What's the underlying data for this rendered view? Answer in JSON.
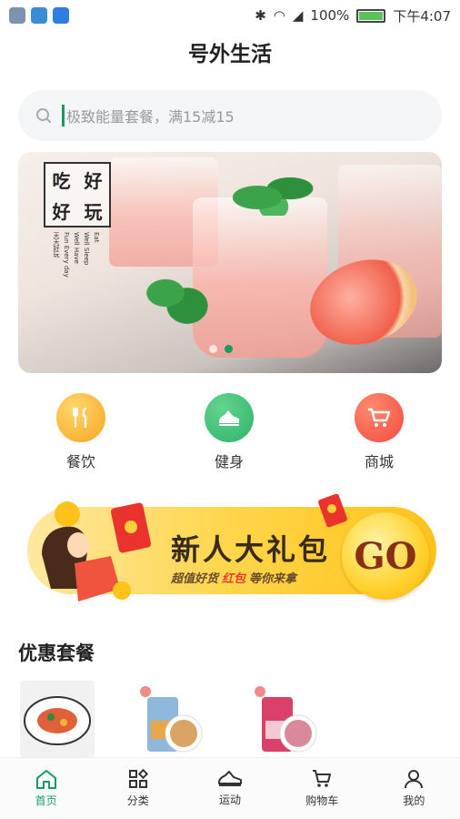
{
  "status_bar": {
    "battery": "100%",
    "time": "下午4:07",
    "battery_level": 1.0
  },
  "page_title": "号外生活",
  "search": {
    "placeholder": "极致能量套餐，满15减15"
  },
  "banner": {
    "tag_chars": [
      "吃",
      "好",
      "好",
      "玩"
    ],
    "tag_sub_lines": [
      "Eat",
      "Well Sleep",
      "Well Have",
      "Fun Every day",
      "天天好玩"
    ],
    "dots": 2,
    "active_dot": 1
  },
  "categories": [
    {
      "label": "餐饮",
      "icon": "fork-knife-icon",
      "color": "#f5a623"
    },
    {
      "label": "健身",
      "icon": "sneaker-icon",
      "color": "#2fb36a"
    },
    {
      "label": "商城",
      "icon": "cart-icon",
      "color": "#f24a3d"
    }
  ],
  "promo": {
    "title": "新人大礼包",
    "sub_a": "超值好货",
    "sub_red": "红包",
    "sub_b": "等你来拿",
    "go": "GO"
  },
  "section": {
    "title": "优惠套餐"
  },
  "tabbar": [
    {
      "label": "首页",
      "icon": "home-icon",
      "active": true
    },
    {
      "label": "分类",
      "icon": "category-icon",
      "active": false
    },
    {
      "label": "运动",
      "icon": "sneaker-icon",
      "active": false
    },
    {
      "label": "购物车",
      "icon": "cart-icon",
      "active": false
    },
    {
      "label": "我的",
      "icon": "person-icon",
      "active": false
    }
  ],
  "colors": {
    "accent": "#1a9a63",
    "promo": "#ffd54a"
  }
}
